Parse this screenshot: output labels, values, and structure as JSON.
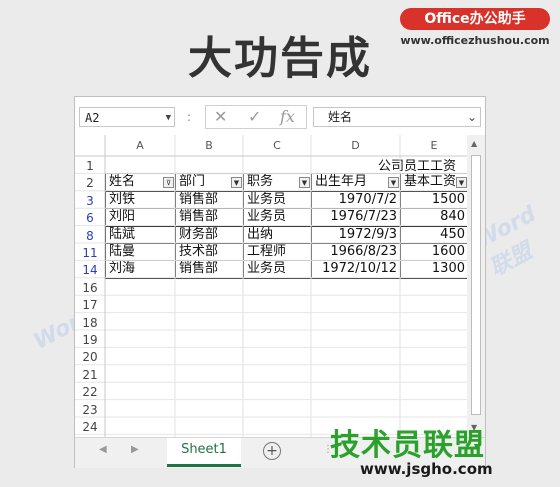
{
  "branding": {
    "logo_text": "Office办公助手",
    "site_url": "www.officezhushou.com",
    "headline": "大功告成",
    "bottom_brand": "技术员联盟",
    "bottom_url": "www.jsgho.com",
    "watermark": "Word联盟"
  },
  "formula_bar": {
    "name_box": "A2",
    "separator": ":",
    "cancel_glyph": "✕",
    "enter_glyph": "✓",
    "fx_glyph": "fx",
    "content": "姓名"
  },
  "columns": [
    "A",
    "B",
    "C",
    "D",
    "E"
  ],
  "row_numbers": [
    "1",
    "2",
    "3",
    "6",
    "8",
    "11",
    "14",
    "16",
    "17",
    "18",
    "19",
    "20",
    "21",
    "22",
    "23",
    "24"
  ],
  "table": {
    "title": "公司员工工资",
    "headers": [
      "姓名",
      "部门",
      "职务",
      "出生年月",
      "基本工资"
    ],
    "rows": [
      [
        "刘铁",
        "销售部",
        "业务员",
        "1970/7/2",
        "1500"
      ],
      [
        "刘阳",
        "销售部",
        "业务员",
        "1976/7/23",
        "840"
      ],
      [
        "陆斌",
        "财务部",
        "出纳",
        "1972/9/3",
        "450"
      ],
      [
        "陆曼",
        "技术部",
        "工程师",
        "1966/8/23",
        "1600"
      ],
      [
        "刘海",
        "销售部",
        "业务员",
        "1972/10/12",
        "1300"
      ]
    ]
  },
  "sheet_tabs": {
    "active": "Sheet1",
    "add_glyph": "+"
  },
  "colors": {
    "accent_green": "#217346",
    "filtered_row_number": "#2a3dbb",
    "logo_red": "#d9322b",
    "brand_green": "#2aa12a"
  }
}
